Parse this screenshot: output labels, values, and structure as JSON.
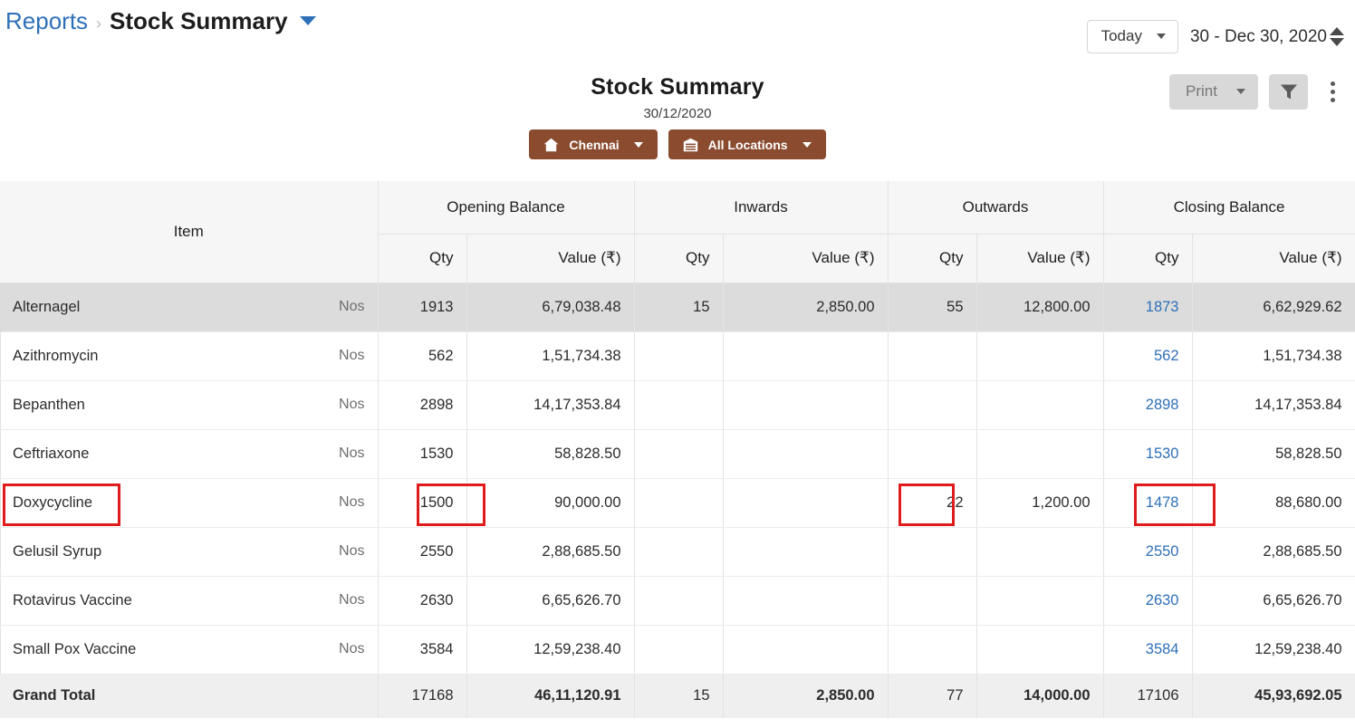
{
  "breadcrumb": {
    "root": "Reports",
    "separator": "›",
    "current": "Stock Summary",
    "caret_icon": "chevron-down-icon"
  },
  "toolbar": {
    "period_label": "Today",
    "date_range": "30 - Dec 30, 2020",
    "print_label": "Print",
    "filter_icon": "filter-icon",
    "more_icon": "kebab-menu-icon",
    "spinner_icon": "spinner-up-down-icon"
  },
  "report": {
    "title": "Stock Summary",
    "date": "30/12/2020",
    "branch_button": {
      "label": "Chennai",
      "icon": "home-icon"
    },
    "location_button": {
      "label": "All Locations",
      "icon": "warehouse-icon"
    }
  },
  "table": {
    "group_headers": [
      "Item",
      "Opening Balance",
      "Inwards",
      "Outwards",
      "Closing Balance"
    ],
    "sub_headers": [
      "Qty",
      "Value (₹)",
      "Qty",
      "Value (₹)",
      "Qty",
      "Value (₹)",
      "Qty",
      "Value (₹)"
    ],
    "uom": "Nos",
    "rows": [
      {
        "item": "Alternagel",
        "uom": "Nos",
        "open_qty": "1913",
        "open_val": "6,79,038.48",
        "in_qty": "15",
        "in_val": "2,850.00",
        "out_qty": "55",
        "out_val": "12,800.00",
        "close_qty": "1873",
        "close_val": "6,62,929.62"
      },
      {
        "item": "Azithromycin",
        "uom": "Nos",
        "open_qty": "562",
        "open_val": "1,51,734.38",
        "in_qty": "",
        "in_val": "",
        "out_qty": "",
        "out_val": "",
        "close_qty": "562",
        "close_val": "1,51,734.38"
      },
      {
        "item": "Bepanthen",
        "uom": "Nos",
        "open_qty": "2898",
        "open_val": "14,17,353.84",
        "in_qty": "",
        "in_val": "",
        "out_qty": "",
        "out_val": "",
        "close_qty": "2898",
        "close_val": "14,17,353.84"
      },
      {
        "item": "Ceftriaxone",
        "uom": "Nos",
        "open_qty": "1530",
        "open_val": "58,828.50",
        "in_qty": "",
        "in_val": "",
        "out_qty": "",
        "out_val": "",
        "close_qty": "1530",
        "close_val": "58,828.50"
      },
      {
        "item": "Doxycycline",
        "uom": "Nos",
        "open_qty": "1500",
        "open_val": "90,000.00",
        "in_qty": "",
        "in_val": "",
        "out_qty": "22",
        "out_val": "1,200.00",
        "close_qty": "1478",
        "close_val": "88,680.00"
      },
      {
        "item": "Gelusil Syrup",
        "uom": "Nos",
        "open_qty": "2550",
        "open_val": "2,88,685.50",
        "in_qty": "",
        "in_val": "",
        "out_qty": "",
        "out_val": "",
        "close_qty": "2550",
        "close_val": "2,88,685.50"
      },
      {
        "item": "Rotavirus Vaccine",
        "uom": "Nos",
        "open_qty": "2630",
        "open_val": "6,65,626.70",
        "in_qty": "",
        "in_val": "",
        "out_qty": "",
        "out_val": "",
        "close_qty": "2630",
        "close_val": "6,65,626.70"
      },
      {
        "item": "Small Pox Vaccine",
        "uom": "Nos",
        "open_qty": "3584",
        "open_val": "12,59,238.40",
        "in_qty": "",
        "in_val": "",
        "out_qty": "",
        "out_val": "",
        "close_qty": "3584",
        "close_val": "12,59,238.40"
      }
    ],
    "grand_total": {
      "label": "Grand Total",
      "open_qty": "17168",
      "open_val": "46,11,120.91",
      "in_qty": "15",
      "in_val": "2,850.00",
      "out_qty": "77",
      "out_val": "14,000.00",
      "close_qty": "17106",
      "close_val": "45,93,692.05"
    },
    "highlight_color": "#e01b1b",
    "link_color": "#2e70b8",
    "highlighted_cells": [
      "Doxycycline",
      "1500",
      "22",
      "1478"
    ]
  }
}
